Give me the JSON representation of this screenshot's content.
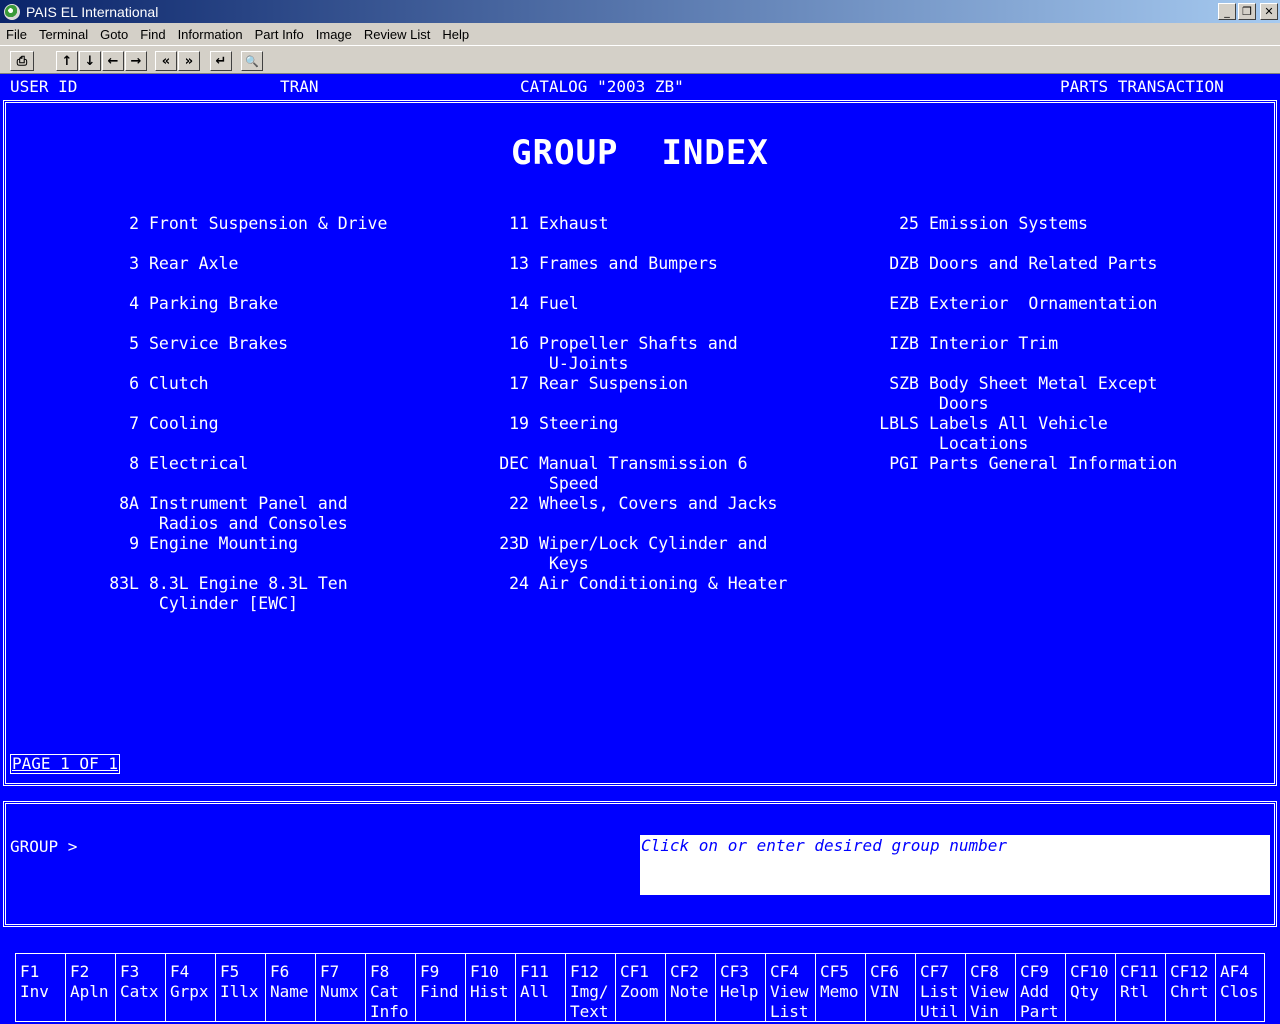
{
  "window": {
    "title": "PAIS EL International"
  },
  "menu": [
    "File",
    "Terminal",
    "Goto",
    "Find",
    "Information",
    "Part Info",
    "Image",
    "Review List",
    "Help"
  ],
  "toolbar": {
    "print": "⎙",
    "up": "↑",
    "down": "↓",
    "left": "←",
    "right": "→",
    "first": "«",
    "last": "»",
    "enter": "↵",
    "search": "🔍"
  },
  "header": {
    "user_id": "USER ID",
    "tran": "TRAN",
    "catalog": "CATALOG \"2003 ZB\"",
    "transaction": "PARTS TRANSACTION"
  },
  "main": {
    "title": "GROUP  INDEX",
    "page": "PAGE 1 OF 1"
  },
  "groups": {
    "col1": [
      {
        "code": "2",
        "l1": "Front Suspension & Drive",
        "l2": ""
      },
      {
        "code": "3",
        "l1": "Rear Axle",
        "l2": ""
      },
      {
        "code": "4",
        "l1": "Parking Brake",
        "l2": ""
      },
      {
        "code": "5",
        "l1": "Service Brakes",
        "l2": ""
      },
      {
        "code": "6",
        "l1": "Clutch",
        "l2": ""
      },
      {
        "code": "7",
        "l1": "Cooling",
        "l2": ""
      },
      {
        "code": "8",
        "l1": "Electrical",
        "l2": ""
      },
      {
        "code": "8A",
        "l1": "Instrument Panel and",
        "l2": " Radios and Consoles"
      },
      {
        "code": "9",
        "l1": "Engine Mounting",
        "l2": ""
      },
      {
        "code": "83L",
        "l1": "8.3L Engine 8.3L Ten",
        "l2": " Cylinder [EWC]"
      }
    ],
    "col2": [
      {
        "code": "11",
        "l1": "Exhaust",
        "l2": ""
      },
      {
        "code": "13",
        "l1": "Frames and Bumpers",
        "l2": ""
      },
      {
        "code": "14",
        "l1": "Fuel",
        "l2": ""
      },
      {
        "code": "16",
        "l1": "Propeller Shafts and",
        "l2": " U-Joints"
      },
      {
        "code": "17",
        "l1": "Rear Suspension",
        "l2": ""
      },
      {
        "code": "19",
        "l1": "Steering",
        "l2": ""
      },
      {
        "code": "DEC",
        "l1": "Manual Transmission 6",
        "l2": " Speed"
      },
      {
        "code": "22",
        "l1": "Wheels, Covers and Jacks",
        "l2": ""
      },
      {
        "code": "23D",
        "l1": "Wiper/Lock Cylinder and",
        "l2": " Keys"
      },
      {
        "code": "24",
        "l1": "Air Conditioning & Heater",
        "l2": ""
      }
    ],
    "col3": [
      {
        "code": "25",
        "l1": "Emission Systems",
        "l2": ""
      },
      {
        "code": "DZB",
        "l1": "Doors and Related Parts",
        "l2": ""
      },
      {
        "code": "EZB",
        "l1": "Exterior  Ornamentation",
        "l2": ""
      },
      {
        "code": "IZB",
        "l1": "Interior Trim",
        "l2": ""
      },
      {
        "code": "SZB",
        "l1": "Body Sheet Metal Except",
        "l2": " Doors"
      },
      {
        "code": "LBLS",
        "l1": "Labels All Vehicle",
        "l2": " Locations"
      },
      {
        "code": "PGI",
        "l1": "Parts General Information",
        "l2": ""
      }
    ]
  },
  "input": {
    "prompt": "GROUP >",
    "message": "Click on or enter desired group number"
  },
  "fkeys": [
    {
      "k": "F1",
      "l": "Inv"
    },
    {
      "k": "F2",
      "l": "Apln"
    },
    {
      "k": "F3",
      "l": "Catx"
    },
    {
      "k": "F4",
      "l": "Grpx"
    },
    {
      "k": "F5",
      "l": "Illx"
    },
    {
      "k": "F6",
      "l": "Name"
    },
    {
      "k": "F7",
      "l": "Numx"
    },
    {
      "k": "F8",
      "l": "Cat\nInfo"
    },
    {
      "k": "F9",
      "l": "Find"
    },
    {
      "k": "F10",
      "l": "Hist"
    },
    {
      "k": "F11",
      "l": "All"
    },
    {
      "k": "F12",
      "l": "Img/\nText"
    },
    {
      "k": "CF1",
      "l": "Zoom"
    },
    {
      "k": "CF2",
      "l": "Note"
    },
    {
      "k": "CF3",
      "l": "Help"
    },
    {
      "k": "CF4",
      "l": "View\nList"
    },
    {
      "k": "CF5",
      "l": "Memo"
    },
    {
      "k": "CF6",
      "l": "VIN"
    },
    {
      "k": "CF7",
      "l": "List\nUtil"
    },
    {
      "k": "CF8",
      "l": "View\nVin"
    },
    {
      "k": "CF9",
      "l": "Add\nPart"
    },
    {
      "k": "CF10",
      "l": "Qty"
    },
    {
      "k": "CF11",
      "l": "Rtl"
    },
    {
      "k": "CF12",
      "l": "Chrt"
    },
    {
      "k": "AF4",
      "l": "Clos"
    }
  ]
}
